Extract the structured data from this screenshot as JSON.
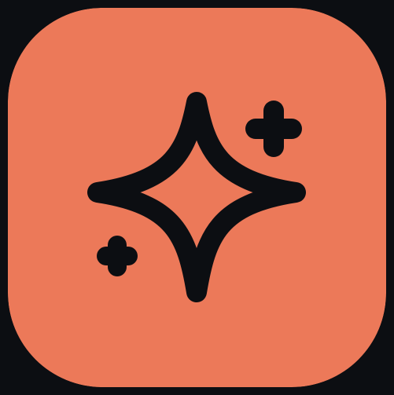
{
  "icon": {
    "name": "sparkles-icon",
    "background_color": "#ec7959",
    "glyph_color": "#0c0e12",
    "page_background_color": "#0c0e12"
  }
}
